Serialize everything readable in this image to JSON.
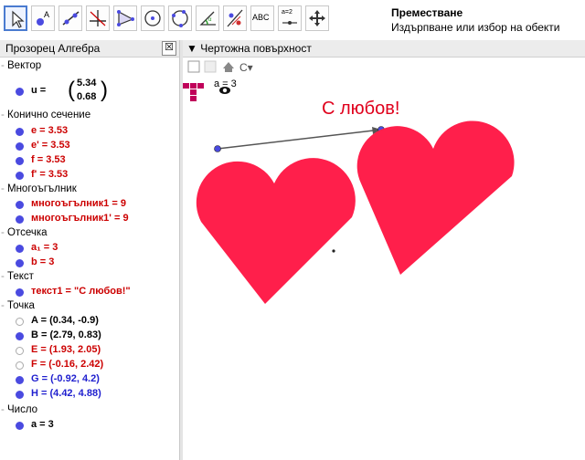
{
  "toolbar": {
    "active_tool_title": "Преместване",
    "active_tool_help": "Издърпване или избор на обекти",
    "tools": [
      "move-tool",
      "point-tool",
      "line-tool",
      "perpendicular-tool",
      "polygon-tool",
      "circle-tool",
      "circle-3pt-tool",
      "angle-tool",
      "reflect-tool",
      "text-tool",
      "slider-tool",
      "move-view-tool"
    ],
    "text_tool_label": "ABC",
    "slider_tool_label": "a=2"
  },
  "algebra": {
    "title": "Прозорец Алгебра",
    "close": "☒",
    "categories": {
      "vector": "Вектор",
      "conic": "Конично сечение",
      "polygon": "Многоъгълник",
      "segment": "Отсечка",
      "text": "Текст",
      "point": "Точка",
      "number": "Число"
    },
    "vector_name": "u =",
    "vector_x": "5.34",
    "vector_y": "0.68",
    "conics": [
      "e = 3.53",
      "e' = 3.53",
      "f = 3.53",
      "f' = 3.53"
    ],
    "polygons": [
      "многоъгълник1 = 9",
      "многоъгълник1' = 9"
    ],
    "segments": [
      "a₁ = 3",
      "b = 3"
    ],
    "texts": [
      "текст1 = \"С любов!\""
    ],
    "points": [
      "A = (0.34, -0.9)",
      "B = (2.79, 0.83)",
      "E = (1.93, 2.05)",
      "F = (-0.16, 2.42)",
      "G = (-0.92, 4.2)",
      "H = (4.42, 4.88)"
    ],
    "numbers": [
      "a = 3"
    ]
  },
  "graphics": {
    "title": "Чертожна повърхност",
    "slider_label": "a = 3",
    "canvas_text": "С любов!"
  },
  "colors": {
    "heart": "#ff1f4b",
    "blue_point": "#4a4ae0",
    "red_text": "#cc0000",
    "blue_text": "#1f1fcf"
  }
}
